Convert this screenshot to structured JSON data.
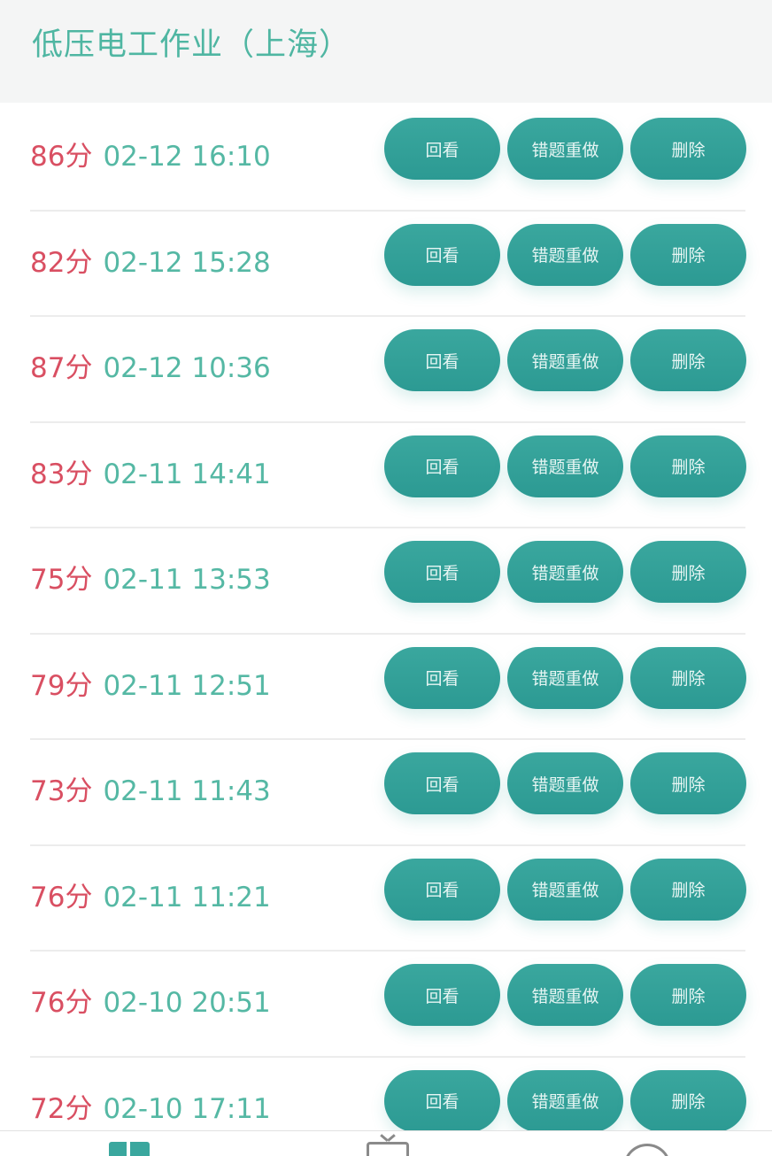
{
  "header": {
    "title": "低压电工作业（上海）"
  },
  "buttons": {
    "review": "回看",
    "redo": "错题重做",
    "delete": "删除"
  },
  "records": [
    {
      "score": "86分",
      "time": "02-12 16:10"
    },
    {
      "score": "82分",
      "time": "02-12 15:28"
    },
    {
      "score": "87分",
      "time": "02-12 10:36"
    },
    {
      "score": "83分",
      "time": "02-11 14:41"
    },
    {
      "score": "75分",
      "time": "02-11 13:53"
    },
    {
      "score": "79分",
      "time": "02-11 12:51"
    },
    {
      "score": "73分",
      "time": "02-11 11:43"
    },
    {
      "score": "76分",
      "time": "02-11 11:21"
    },
    {
      "score": "76分",
      "time": "02-10 20:51"
    },
    {
      "score": "72分",
      "time": "02-10 17:11"
    }
  ],
  "bottom_nav": [
    {
      "icon": "book-icon",
      "active": true
    },
    {
      "icon": "tv-icon",
      "active": false
    },
    {
      "icon": "face-icon",
      "active": false
    }
  ],
  "colors": {
    "accent": "#3aa79e",
    "score": "#d94f62",
    "time": "#55b8a4"
  }
}
